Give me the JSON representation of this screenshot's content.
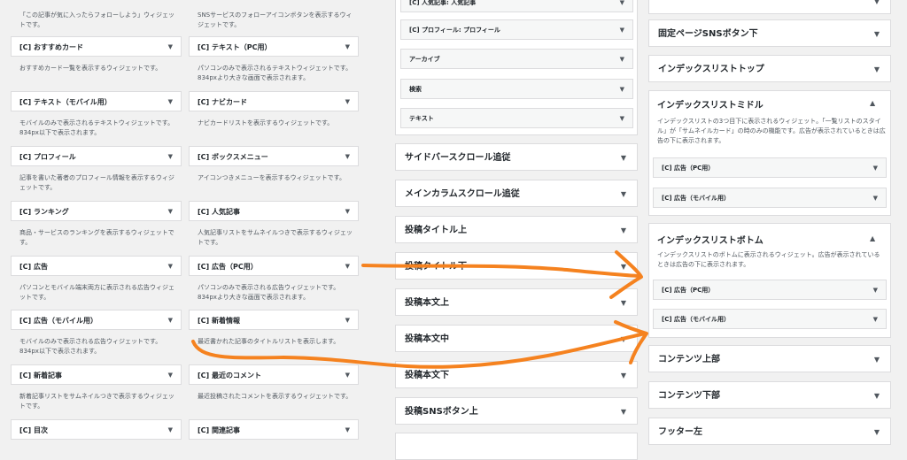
{
  "left_col1": {
    "top_desc": "「この記事が気に入ったらフォローしよう」ウィジェットです。",
    "items": [
      {
        "label": "[C] おすすめカード",
        "desc": "おすすめカード一覧を表示するウィジェットです。"
      },
      {
        "label": "[C] テキスト（モバイル用）",
        "desc": "モバイルのみで表示されるテキストウィジェットです。834px以下で表示されます。"
      },
      {
        "label": "[C] プロフィール",
        "desc": "記事を書いた著者のプロフィール情報を表示するウィジェットです。"
      },
      {
        "label": "[C] ランキング",
        "desc": "商品・サービスのランキングを表示するウィジェットです。"
      },
      {
        "label": "[C] 広告",
        "desc": "パソコンとモバイル端末両方に表示される広告ウィジェットです。"
      },
      {
        "label": "[C] 広告（モバイル用）",
        "desc": "モバイルのみで表示される広告ウィジェットです。834px以下で表示されます。"
      },
      {
        "label": "[C] 新着記事",
        "desc": "新着記事リストをサムネイルつきで表示するウィジェットです。"
      },
      {
        "label": "[C] 目次",
        "desc": ""
      }
    ]
  },
  "left_col2": {
    "top_desc": "SNSサービスのフォローアイコンボタンを表示するウィジェットです。",
    "items": [
      {
        "label": "[C] テキスト（PC用）",
        "desc": "パソコンのみで表示されるテキストウィジェットです。834pxより大きな画面で表示されます。"
      },
      {
        "label": "[C] ナビカード",
        "desc": "ナビカードリストを表示するウィジェットです。"
      },
      {
        "label": "[C] ボックスメニュー",
        "desc": "アイコンつきメニューを表示するウィジェットです。"
      },
      {
        "label": "[C] 人気記事",
        "desc": "人気記事リストをサムネイルつきで表示するウィジェットです。"
      },
      {
        "label": "[C] 広告（PC用）",
        "desc": "パソコンのみで表示される広告ウィジェットです。834pxより大きな画面で表示されます。"
      },
      {
        "label": "[C] 新着情報",
        "desc": "最近書かれた記事のタイトルリストを表示します。"
      },
      {
        "label": "[C] 最近のコメント",
        "desc": "最近投稿されたコメントを表示するウィジェットです。"
      },
      {
        "label": "[C] 関連記事",
        "desc": ""
      }
    ]
  },
  "mid": {
    "inner_items": [
      "[C] 人気記事: 人気記事",
      "[C] プロフィール: プロフィール",
      "アーカイブ",
      "検索",
      "テキスト"
    ],
    "areas": [
      "サイドバースクロール追従",
      "メインカラムスクロール追従",
      "投稿タイトル上",
      "投稿タイトル下",
      "投稿本文上",
      "投稿本文中",
      "投稿本文下",
      "投稿SNSボタン上",
      ""
    ]
  },
  "right": {
    "top_areas": [
      "",
      "固定ページSNSボタン下",
      "インデックスリストトップ"
    ],
    "middle": {
      "title": "インデックスリストミドル",
      "desc": "インデックスリストの3つ目下に表示されるウィジェット。「一覧リストのスタイル」が「サムネイルカード」の時のみの機能です。広告が表示されているときは広告の下に表示されます。",
      "items": [
        "[C] 広告（PC用）",
        "[C] 広告（モバイル用）"
      ]
    },
    "bottom": {
      "title": "インデックスリストボトム",
      "desc": "インデックスリストのボトムに表示されるウィジェット。広告が表示されているときは広告の下に表示されます。",
      "items": [
        "[C] 広告（PC用）",
        "[C] 広告（モバイル用）"
      ]
    },
    "after_areas": [
      "コンテンツ上部",
      "コンテンツ下部",
      "フッター左"
    ]
  },
  "icons": {
    "collapse": "▼",
    "expand": "▲"
  },
  "annotation_color": "#f5821f"
}
